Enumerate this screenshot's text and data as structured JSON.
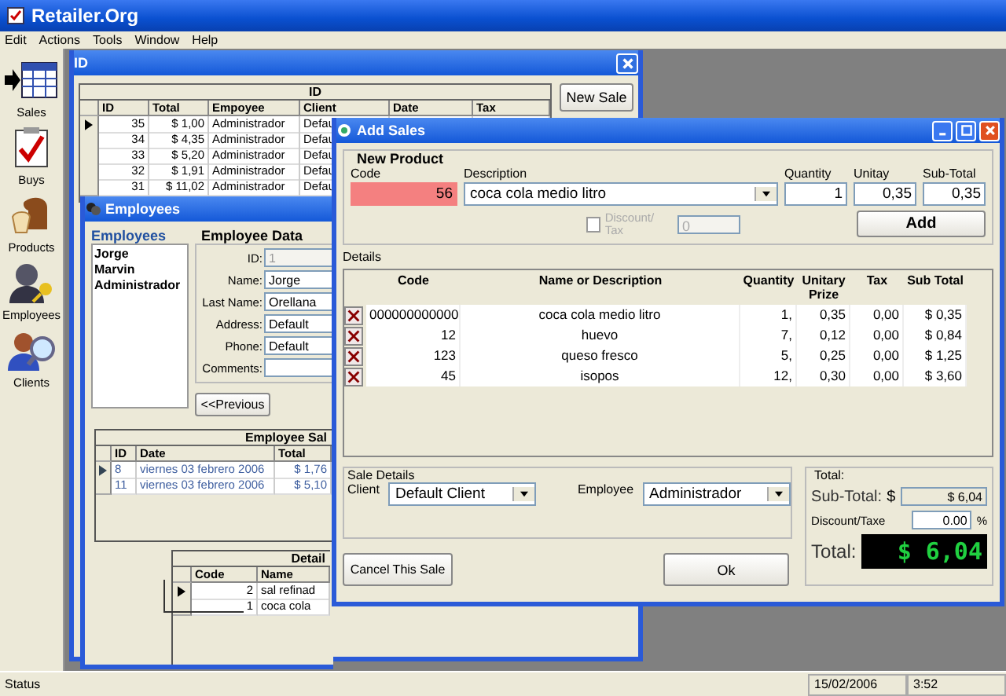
{
  "app": {
    "title": "Retailer.Org"
  },
  "menu": [
    {
      "label": "Edit"
    },
    {
      "label": "Actions"
    },
    {
      "label": "Tools"
    },
    {
      "label": "Window"
    },
    {
      "label": "Help"
    }
  ],
  "sidebar": [
    {
      "label": "Sales",
      "kind": "sales"
    },
    {
      "label": "Buys",
      "kind": "buys"
    },
    {
      "label": "Products",
      "kind": "products"
    },
    {
      "label": "Employees",
      "kind": "employees"
    },
    {
      "label": "Clients",
      "kind": "clients"
    }
  ],
  "sales_window": {
    "title": "ID",
    "caption": "ID",
    "columns": [
      "ID",
      "Total",
      "Empoyee",
      "Client",
      "Date",
      "Tax"
    ],
    "rows": [
      {
        "selected": true,
        "cells": [
          "35",
          "$ 1,00",
          "Administrador",
          "Defau"
        ]
      },
      {
        "selected": false,
        "cells": [
          "34",
          "$ 4,35",
          "Administrador",
          "Defau"
        ]
      },
      {
        "selected": false,
        "cells": [
          "33",
          "$ 5,20",
          "Administrador",
          "Defau"
        ]
      },
      {
        "selected": false,
        "cells": [
          "32",
          "$ 1,91",
          "Administrador",
          "Defau"
        ]
      },
      {
        "selected": false,
        "cells": [
          "31",
          "$ 11,02",
          "Administrador",
          "Defau"
        ]
      }
    ],
    "new_sale_button": "New Sale"
  },
  "employees_window": {
    "title": "Employees",
    "list_label": "Employees",
    "employees": [
      {
        "name": "Jorge"
      },
      {
        "name": "Marvin"
      },
      {
        "name": "Administrador"
      }
    ],
    "data_legend": "Employee Data",
    "fields": [
      {
        "label": "ID:",
        "value": "1",
        "disabled": true
      },
      {
        "label": "Name:",
        "value": "Jorge",
        "disabled": false
      },
      {
        "label": "Last Name:",
        "value": "Orellana",
        "disabled": false
      },
      {
        "label": "Address:",
        "value": "Default",
        "disabled": false
      },
      {
        "label": "Phone:",
        "value": "Default",
        "disabled": false
      },
      {
        "label": "Comments:",
        "disabled": false
      }
    ],
    "previous_button": "<<Previous",
    "sales_grid": {
      "caption": "Employee Sal",
      "columns": [
        "ID",
        "Date",
        "Total"
      ],
      "rows": [
        {
          "selected": true,
          "cells": [
            "8",
            "viernes 03 febrero 2006",
            "$ 1,76"
          ]
        },
        {
          "selected": false,
          "cells": [
            "11",
            "viernes 03 febrero 2006",
            "$ 5,10"
          ]
        }
      ]
    },
    "detail_grid": {
      "caption": "Detail",
      "columns": [
        "Code",
        "Name"
      ],
      "rows": [
        {
          "selected": true,
          "cells": [
            "2",
            "sal refinad"
          ]
        },
        {
          "selected": false,
          "cells": [
            "1",
            "coca cola"
          ]
        }
      ]
    }
  },
  "add_sales_window": {
    "title": "Add Sales",
    "new_product": {
      "legend": "New Product",
      "code_label": "Code",
      "code": "56",
      "description_label": "Description",
      "description": "coca cola medio litro",
      "quantity_label": "Quantity",
      "quantity": "1",
      "unitary_label": "Unitay",
      "unitary": "0,35",
      "subtotal_label": "Sub-Total",
      "subtotal": "0,35",
      "discount_label": "Discount/ Tax",
      "discount_checked": false,
      "discount_disabled": true,
      "discount_value": "0",
      "add_button": "Add"
    },
    "details_label": "Details",
    "details": {
      "columns": [
        "Code",
        "Name or Description",
        "Quantity",
        "Unitary Prize",
        "Tax",
        "Sub Total"
      ],
      "rows": [
        {
          "cells": [
            "000000000000",
            "coca cola medio litro",
            "1,",
            "0,35",
            "0,00",
            "$ 0,35"
          ]
        },
        {
          "cells": [
            "12",
            "huevo",
            "7,",
            "0,12",
            "0,00",
            "$ 0,84"
          ]
        },
        {
          "cells": [
            "123",
            "queso fresco",
            "5,",
            "0,25",
            "0,00",
            "$ 1,25"
          ]
        },
        {
          "cells": [
            "45",
            "isopos",
            "12,",
            "0,30",
            "0,00",
            "$ 3,60"
          ]
        }
      ]
    },
    "sale_details": {
      "legend": "Sale Details",
      "client_label": "Client",
      "client": "Default Client",
      "employee_label": "Employee",
      "employee": "Administrador"
    },
    "totals": {
      "legend": "Total:",
      "subtotal_label": "Sub-Total:",
      "currency": "$",
      "subtotal": "$ 6,04",
      "discount_label": "Discount/Taxe",
      "discount": "0.00",
      "percent": "%",
      "total_label": "Total:",
      "total": "$ 6,04"
    },
    "cancel_button": "Cancel This Sale",
    "ok_button": "Ok"
  },
  "status_bar": {
    "status": "Status",
    "date": "15/02/2006",
    "time": "3:52"
  }
}
